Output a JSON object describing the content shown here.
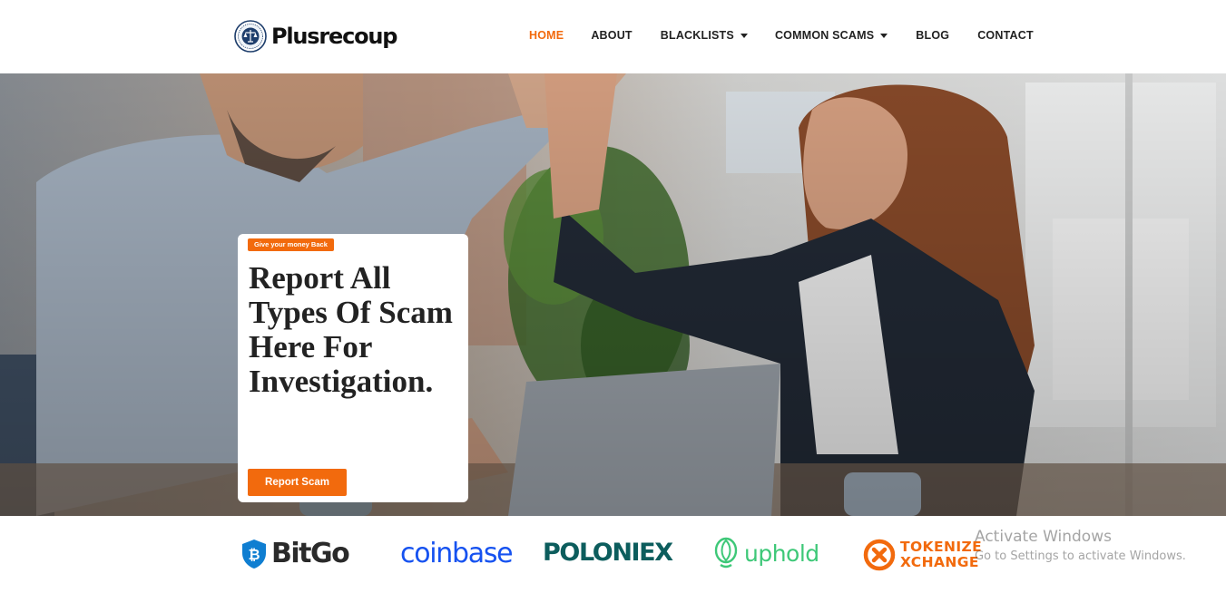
{
  "brand": {
    "name": "Plusrecoup"
  },
  "nav": {
    "items": [
      {
        "label": "HOME",
        "dropdown": false
      },
      {
        "label": "ABOUT",
        "dropdown": false
      },
      {
        "label": "BLACKLISTS",
        "dropdown": true
      },
      {
        "label": "COMMON SCAMS",
        "dropdown": true
      },
      {
        "label": "BLOG",
        "dropdown": false
      },
      {
        "label": "CONTACT",
        "dropdown": false
      }
    ]
  },
  "hero": {
    "tag": "Give your money Back",
    "headline": "Report All Types Of Scam Here For Investigation.",
    "cta_label": "Report Scam"
  },
  "partners": {
    "bitgo": "BitGo",
    "coinbase": "coinbase",
    "poloniex": "POLONIEX",
    "uphold": "uphold",
    "tokenize_line1": "TOKENIZE",
    "tokenize_line2": "XCHANGE"
  },
  "watermark": {
    "title": "Activate Windows",
    "subtitle": "Go to Settings to activate Windows."
  },
  "colors": {
    "accent": "#f26a0d",
    "active_nav": "#f26a0d",
    "text": "#222222"
  },
  "icons": [
    "logo-seal-icon",
    "caret-down-icon",
    "bitgo-shield-icon",
    "uphold-icon",
    "tokenize-x-icon"
  ]
}
